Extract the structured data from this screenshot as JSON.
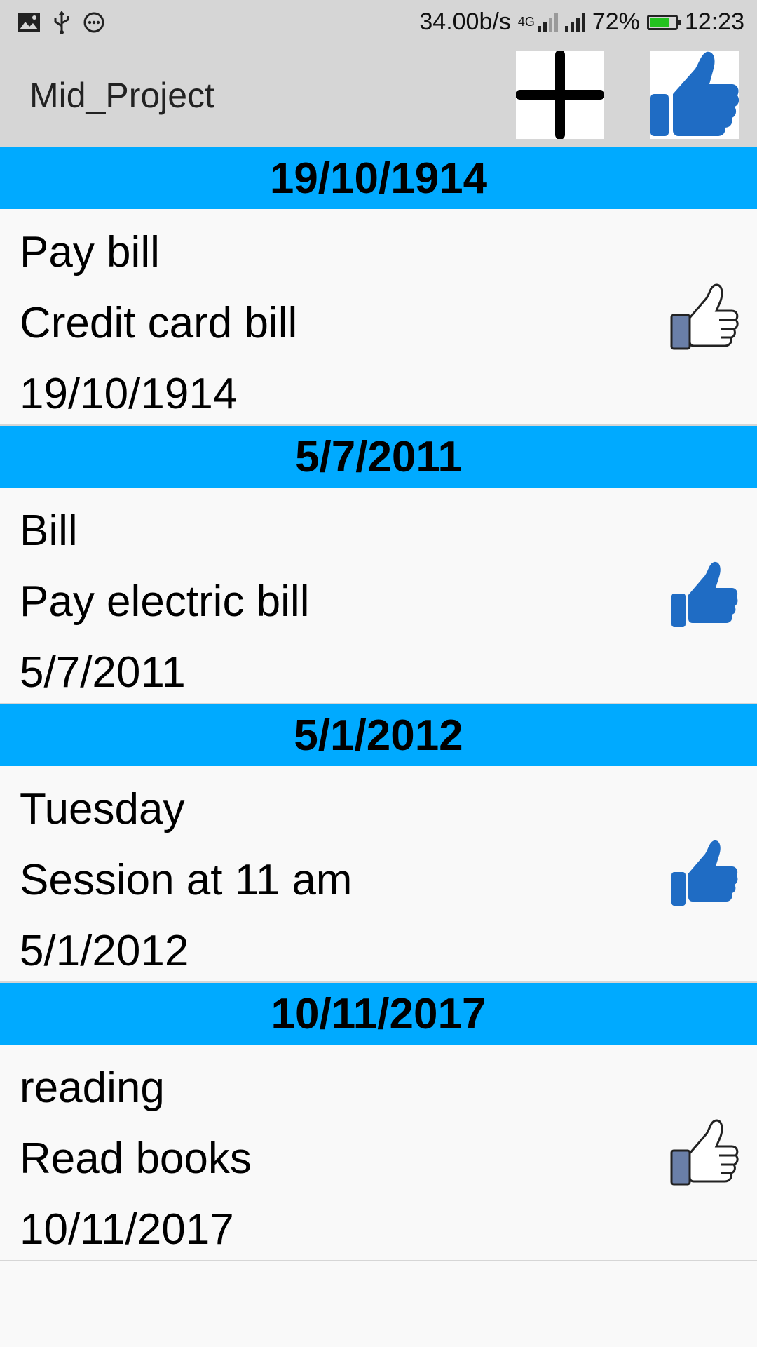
{
  "status_bar": {
    "speed": "34.00b/s",
    "network_type": "4G",
    "battery": "72%",
    "time": "12:23",
    "icons": [
      "image-icon",
      "usb-icon",
      "more-circle-icon",
      "signal-icon",
      "battery-icon"
    ]
  },
  "app_bar": {
    "title": "Mid_Project",
    "add_icon": "plus-icon",
    "like_icon": "thumbs-up-filled-icon"
  },
  "colors": {
    "section_header": "#00aaff",
    "like_filled": "#1f6cc4",
    "like_outline_cuff": "#6a7fa8",
    "app_bar": "#d6d6d6"
  },
  "items": [
    {
      "header": "19/10/1914",
      "title": "Pay bill",
      "description": "Credit card bill",
      "date": "19/10/1914",
      "liked": false
    },
    {
      "header": "5/7/2011",
      "title": "Bill",
      "description": "Pay electric bill",
      "date": "5/7/2011",
      "liked": true
    },
    {
      "header": "5/1/2012",
      "title": "Tuesday",
      "description": "Session at 11 am",
      "date": "5/1/2012",
      "liked": true
    },
    {
      "header": "10/11/2017",
      "title": "reading",
      "description": "Read books",
      "date": "10/11/2017",
      "liked": false
    }
  ]
}
